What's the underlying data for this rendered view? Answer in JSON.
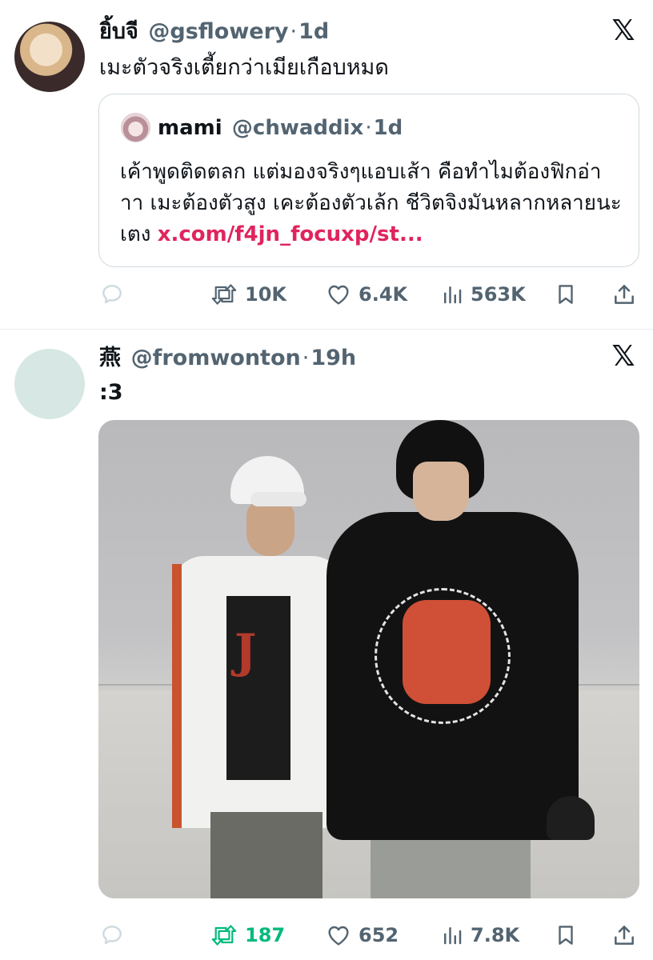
{
  "tweets": [
    {
      "author_name": "ยิ้บจี",
      "handle": "@gsflowery",
      "separator": "·",
      "time": "1d",
      "text": "เมะตัวจริงเตี้ยกว่าเมียเกือบหมด",
      "quote": {
        "author_name": "mami",
        "handle": "@chwaddix",
        "separator": "·",
        "time": "1d",
        "text": "เค้าพูดติดตลก แต่มองจริงๆแอบเส้า คือทำไมต้องฟิกอ่าาา เมะต้องตัวสูง เคะต้องตัวเล้ก ชีวิตจิงมันหลากหลายนะเตง",
        "link": "x.com/f4jn_focuxp/st..."
      },
      "stats": {
        "retweets": "10K",
        "likes": "6.4K",
        "views": "563K"
      }
    },
    {
      "author_name": "燕",
      "handle": "@fromwonton",
      "separator": "·",
      "time": "19h",
      "text": ":3",
      "stats": {
        "retweets": "187",
        "likes": "652",
        "views": "7.8K"
      }
    }
  ],
  "icons": {
    "logo": "x-logo-icon",
    "reply": "reply-bubble-icon",
    "retweet": "retweet-icon",
    "like": "heart-icon",
    "views": "views-bar-chart-icon",
    "bookmark": "bookmark-icon",
    "share": "share-upload-icon"
  },
  "colors": {
    "text": "#0f1419",
    "muted": "#536471",
    "link": "#e0245e",
    "retweet_active": "#00ba7c",
    "border": "#cfd9de"
  }
}
